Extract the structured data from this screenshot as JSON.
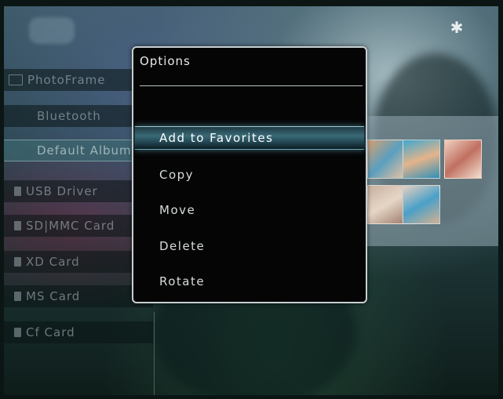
{
  "sidebar": {
    "items": [
      {
        "label": "PhotoFrame"
      },
      {
        "label": "Bluetooth"
      },
      {
        "label": "Default Album"
      },
      {
        "label": "USB Driver"
      },
      {
        "label": "SD|MMC Card"
      },
      {
        "label": "XD Card"
      },
      {
        "label": "MS Card"
      },
      {
        "label": "Cf Card"
      }
    ]
  },
  "status": {
    "bluetooth_symbol": "✱"
  },
  "dialog": {
    "title": "Options",
    "items": [
      {
        "label": "Add to Favorites",
        "selected": true
      },
      {
        "label": "Copy"
      },
      {
        "label": "Move"
      },
      {
        "label": "Delete"
      },
      {
        "label": "Rotate"
      }
    ]
  }
}
